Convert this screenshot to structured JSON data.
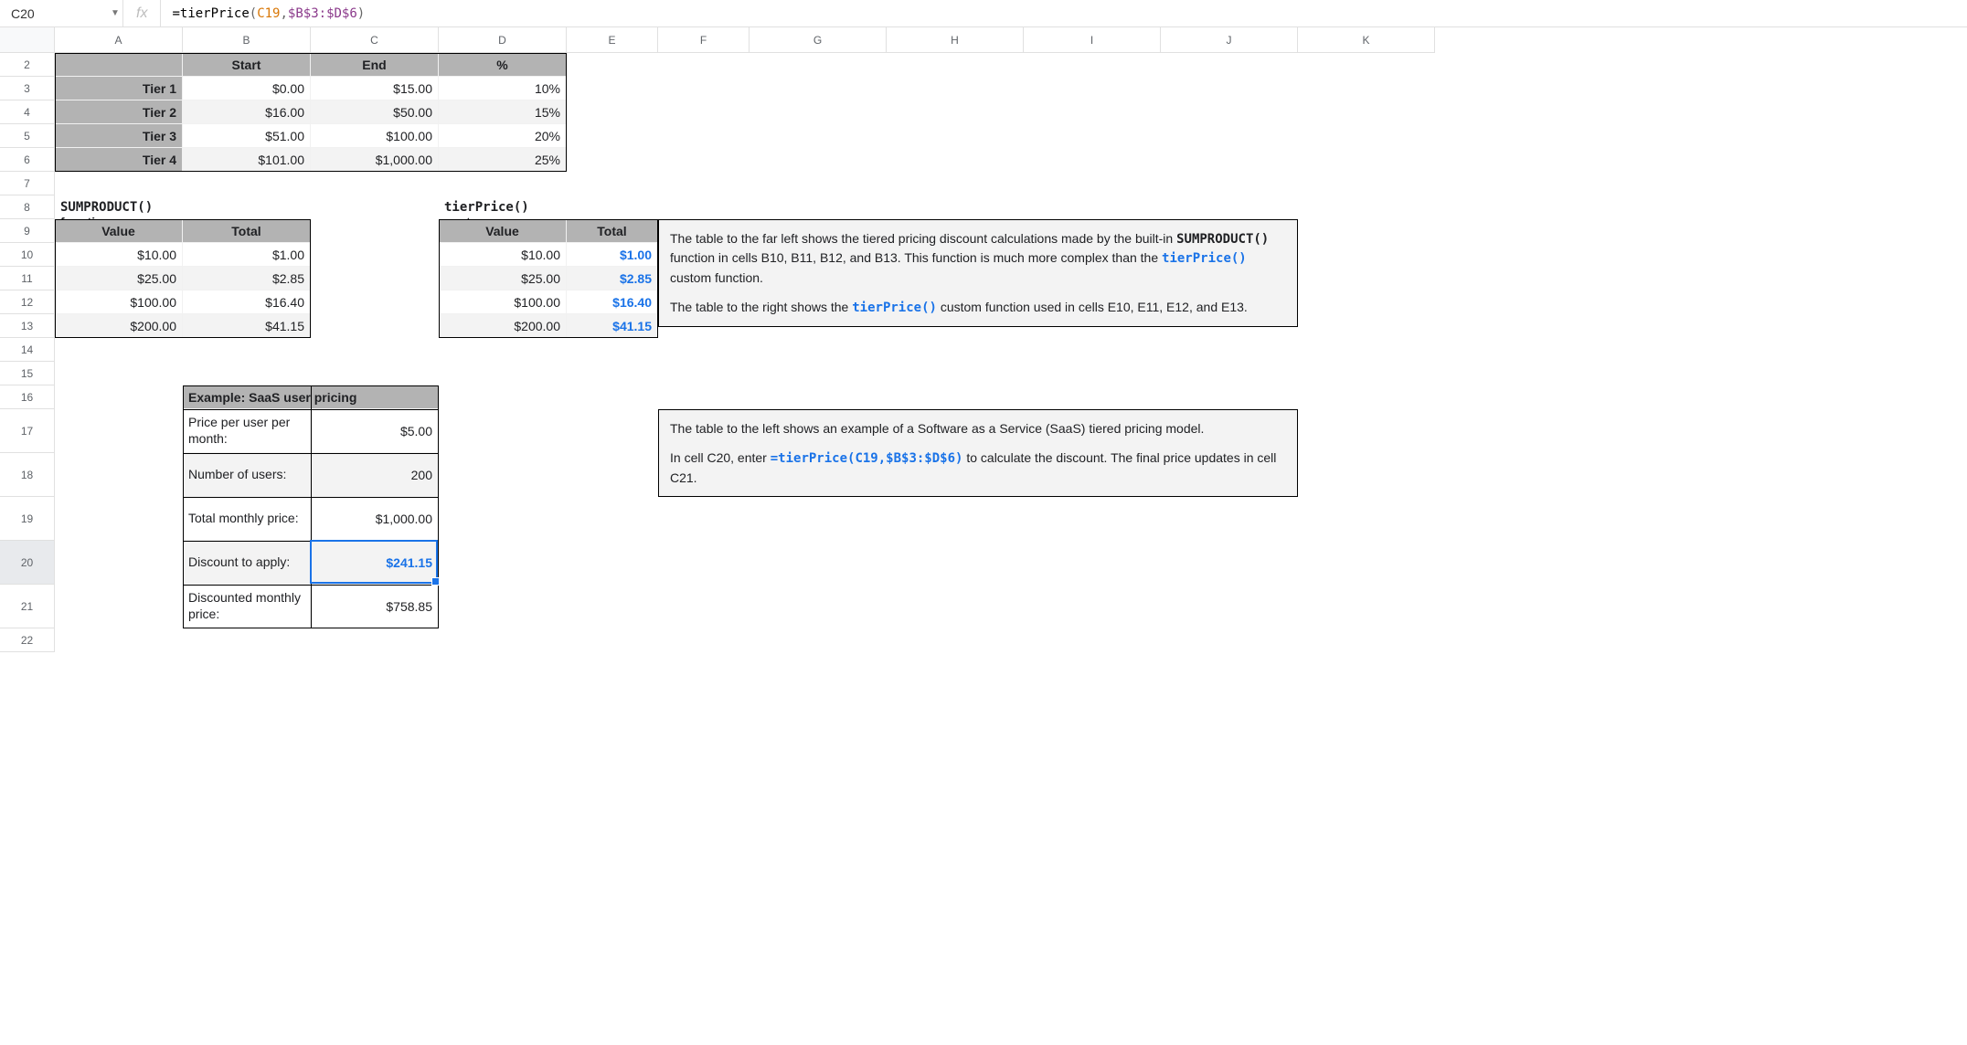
{
  "namebox": "C20",
  "formula": {
    "eq": "=",
    "fn": "tierPrice",
    "open": "(",
    "arg1": "C19",
    "comma": ",",
    "arg2": "$B$3:$D$6",
    "close": ")"
  },
  "columns": [
    "A",
    "B",
    "C",
    "D",
    "E",
    "F",
    "G",
    "H",
    "I",
    "J",
    "K"
  ],
  "rows": [
    "2",
    "3",
    "4",
    "5",
    "6",
    "7",
    "8",
    "9",
    "10",
    "11",
    "12",
    "13",
    "14",
    "15",
    "16",
    "17",
    "18",
    "19",
    "20",
    "21",
    "22"
  ],
  "tiersHeader": {
    "b": "Start",
    "c": "End",
    "d": "%"
  },
  "tiers": [
    {
      "name": "Tier 1",
      "start": "$0.00",
      "end": "$15.00",
      "pct": "10%"
    },
    {
      "name": "Tier 2",
      "start": "$16.00",
      "end": "$50.00",
      "pct": "15%"
    },
    {
      "name": "Tier 3",
      "start": "$51.00",
      "end": "$100.00",
      "pct": "20%"
    },
    {
      "name": "Tier 4",
      "start": "$101.00",
      "end": "$1,000.00",
      "pct": "25%"
    }
  ],
  "section1": {
    "code": "SUMPRODUCT()",
    "rest": " function"
  },
  "section2": {
    "code": "tierPrice()",
    "rest": " custom function"
  },
  "vthdr": {
    "v": "Value",
    "t": "Total"
  },
  "vt1": [
    {
      "v": "$10.00",
      "t": "$1.00"
    },
    {
      "v": "$25.00",
      "t": "$2.85"
    },
    {
      "v": "$100.00",
      "t": "$16.40"
    },
    {
      "v": "$200.00",
      "t": "$41.15"
    }
  ],
  "vt2": [
    {
      "v": "$10.00",
      "t": "$1.00"
    },
    {
      "v": "$25.00",
      "t": "$2.85"
    },
    {
      "v": "$100.00",
      "t": "$16.40"
    },
    {
      "v": "$200.00",
      "t": "$41.15"
    }
  ],
  "saas": {
    "title": "Example: SaaS user pricing",
    "rows": [
      {
        "label": "Price per user per month:",
        "val": "$5.00"
      },
      {
        "label": "Number of users:",
        "val": "200"
      },
      {
        "label": "Total monthly price:",
        "val": "$1,000.00"
      },
      {
        "label": "Discount to apply:",
        "val": "$241.15"
      },
      {
        "label": "Discounted monthly price:",
        "val": "$758.85"
      }
    ]
  },
  "info1": {
    "p1a": "The table to the far left shows the tiered pricing discount calculations made by the built-in ",
    "p1code": "SUMPRODUCT()",
    "p1b": " function in cells B10, B11, B12, and B13. This function is much more complex than the ",
    "p1fn": "tierPrice()",
    "p1c": " custom function.",
    "p2a": "The table to the right shows the ",
    "p2fn": "tierPrice()",
    "p2b": " custom function used in cells E10, E11, E12, and E13."
  },
  "info2": {
    "p1": "The table to the left shows an example of a Software as a Service (SaaS) tiered pricing model.",
    "p2a": "In cell C20, enter ",
    "p2code": "=tierPrice(C19,$B$3:$D$6)",
    "p2b": " to calculate the discount. The final price updates in cell C21."
  }
}
